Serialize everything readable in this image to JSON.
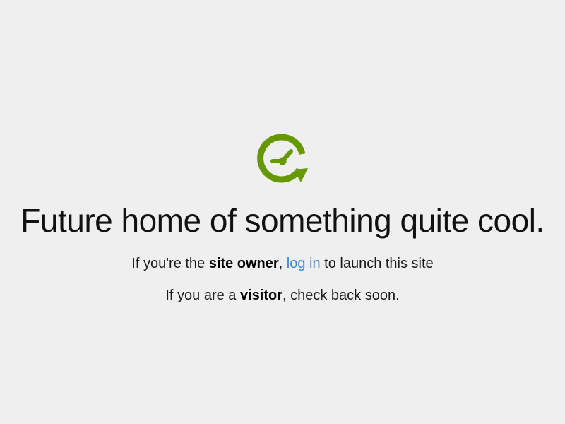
{
  "brand": {
    "logo_icon": "clock-refresh-icon",
    "logo_color": "#669900"
  },
  "headline": "Future home of something quite cool.",
  "owner_line": {
    "prefix": "If you're the ",
    "strong": "site owner",
    "comma": ", ",
    "link_text": "log in",
    "suffix": " to launch this site",
    "link_color": "#3a87d3"
  },
  "visitor_line": {
    "prefix": "If you are a ",
    "strong": "visitor",
    "suffix": ", check back soon."
  }
}
